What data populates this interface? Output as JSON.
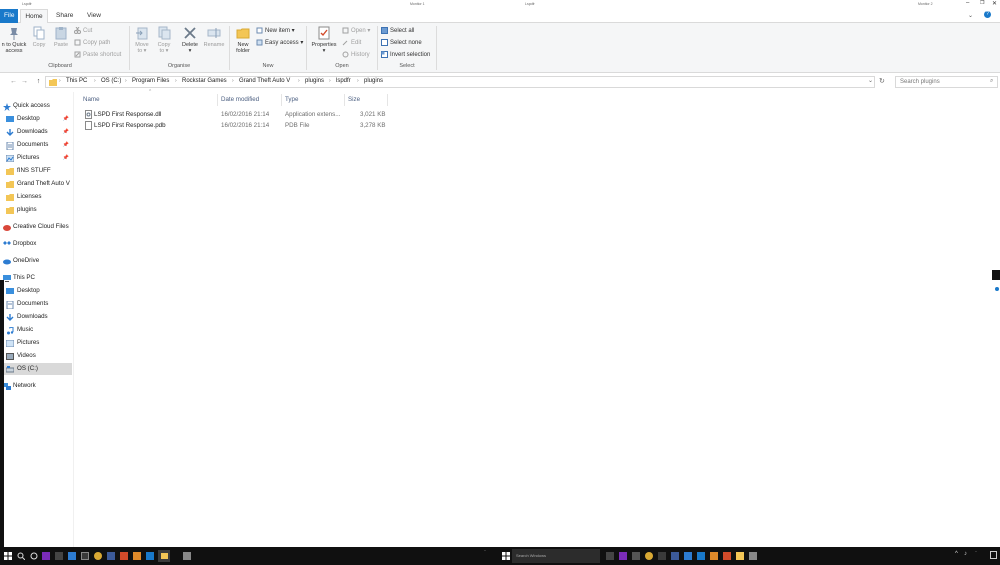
{
  "window": {
    "top_strip": {
      "left_title": "Lspdfr",
      "center_label": "Monitor 1",
      "right_title": "Lspdfr",
      "right_label": "Monitor 2"
    }
  },
  "ribbon": {
    "tabs": [
      {
        "label": "File"
      },
      {
        "label": "Home"
      },
      {
        "label": "Share"
      },
      {
        "label": "View"
      }
    ],
    "clipboard": {
      "pin_label_1": "n to Quick",
      "pin_label_2": "access",
      "copy": "Copy",
      "paste": "Paste",
      "cut": "Cut",
      "copy_path": "Copy path",
      "paste_shortcut": "Paste shortcut",
      "group": "Clipboard"
    },
    "organise": {
      "move_to_1": "Move",
      "move_to_2": "to ▾",
      "copy_to_1": "Copy",
      "copy_to_2": "to ▾",
      "delete_1": "Delete",
      "delete_2": "▾",
      "rename": "Rename",
      "group": "Organise"
    },
    "new": {
      "new_folder_1": "New",
      "new_folder_2": "folder",
      "new_item": "New item ▾",
      "easy_access": "Easy access ▾",
      "group": "New"
    },
    "open": {
      "properties_1": "Properties",
      "properties_2": "▾",
      "open": "Open ▾",
      "edit": "Edit",
      "history": "History",
      "group": "Open"
    },
    "select": {
      "select_all": "Select all",
      "select_none": "Select none",
      "invert_selection": "Invert selection",
      "group": "Select"
    }
  },
  "address": {
    "back": "←",
    "forward": "→",
    "up": "↑",
    "crumbs": [
      "This PC",
      "OS (C:)",
      "Program Files",
      "Rockstar Games",
      "Grand Theft Auto V",
      "plugins",
      "lspdfr",
      "plugins"
    ],
    "search_placeholder": "Search plugins"
  },
  "navpane": {
    "quick_access": "Quick access",
    "quick": [
      {
        "label": "Desktop",
        "pinned": true
      },
      {
        "label": "Downloads",
        "pinned": true
      },
      {
        "label": "Documents",
        "pinned": true
      },
      {
        "label": "Pictures",
        "pinned": true
      },
      {
        "label": "fINS STUFF",
        "pinned": false
      },
      {
        "label": "Grand Theft Auto V",
        "pinned": false
      },
      {
        "label": "Licenses",
        "pinned": false
      },
      {
        "label": "plugins",
        "pinned": false
      }
    ],
    "creative_cloud": "Creative Cloud Files",
    "dropbox": "Dropbox",
    "onedrive": "OneDrive",
    "this_pc": "This PC",
    "pc_items": [
      "Desktop",
      "Documents",
      "Downloads",
      "Music",
      "Pictures",
      "Videos",
      "OS (C:)"
    ],
    "network": "Network"
  },
  "columns": {
    "name": "Name",
    "date": "Date modified",
    "type": "Type",
    "size": "Size"
  },
  "files": [
    {
      "name": "LSPD First Response.dll",
      "date": "16/02/2016 21:14",
      "type": "Application extens...",
      "size": "3,021 KB"
    },
    {
      "name": "LSPD First Response.pdb",
      "date": "16/02/2016 21:14",
      "type": "PDB File",
      "size": "3,278 KB"
    }
  ],
  "taskbar": {
    "search_placeholder": "Search Windows"
  },
  "colors": {
    "accent": "#1979ca",
    "selected_nav": "#cce8ff",
    "taskbar": "#101010",
    "folder": "#f3c656"
  }
}
